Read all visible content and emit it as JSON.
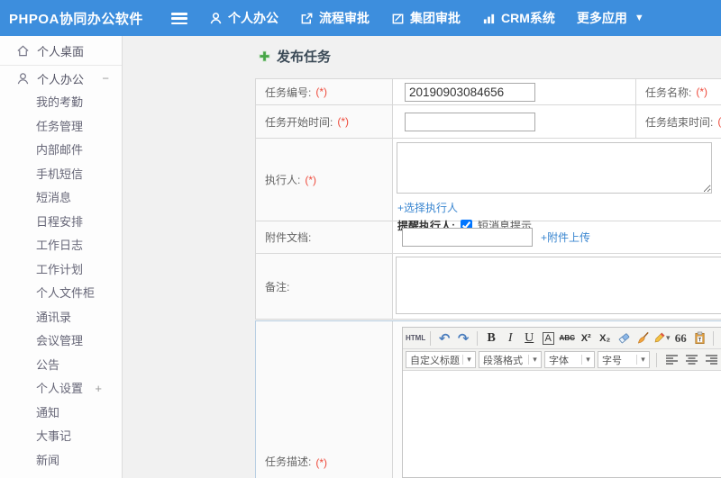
{
  "colors": {
    "header_blue": "#3d8edd",
    "link_blue": "#3a86d0",
    "required_red": "#ee4b3c",
    "plus_green": "#46a546",
    "title_text": "#3b4a57"
  },
  "header": {
    "logo": "PHPOA协同办公软件",
    "nav": [
      {
        "label": "个人办公"
      },
      {
        "label": "流程审批"
      },
      {
        "label": "集团审批"
      },
      {
        "label": "CRM系统"
      },
      {
        "label": "更多应用"
      }
    ]
  },
  "sidebar": {
    "desktop_label": "个人桌面",
    "section_label": "个人办公",
    "section_toggle": "−",
    "settings_toggle": "+",
    "items": [
      "我的考勤",
      "任务管理",
      "内部邮件",
      "手机短信",
      "短消息",
      "日程安排",
      "工作日志",
      "工作计划",
      "个人文件柜",
      "通讯录",
      "会议管理",
      "公告",
      "个人设置",
      "通知",
      "大事记",
      "新闻"
    ]
  },
  "main": {
    "title": "发布任务",
    "form": {
      "required_mark": "(*)",
      "task_number_label": "任务编号:",
      "task_number_value": "20190903084656",
      "task_name_label": "任务名称:",
      "start_time_label": "任务开始时间:",
      "end_time_label": "任务结束时间:",
      "executor_label": "执行人:",
      "choose_executor_link": "+选择执行人",
      "remind_label": "提醒执行人:",
      "sms_label": "短消息提示",
      "attachment_label": "附件文档:",
      "attachment_upload_link": "+附件上传",
      "remark_label": "备注:",
      "description_label": "任务描述:"
    },
    "editor": {
      "html_label": "HTML",
      "bold_label": "B",
      "italic_label": "I",
      "underline_label": "U",
      "font_box_label": "A",
      "strike_label": "ABC",
      "sup_label": "X²",
      "sub_label": "X₂",
      "quote_label": "66",
      "color_label": "A",
      "heading_select": "自定义标题",
      "paragraph_select": "段落格式",
      "font_select": "字体",
      "size_select": "字号"
    }
  }
}
